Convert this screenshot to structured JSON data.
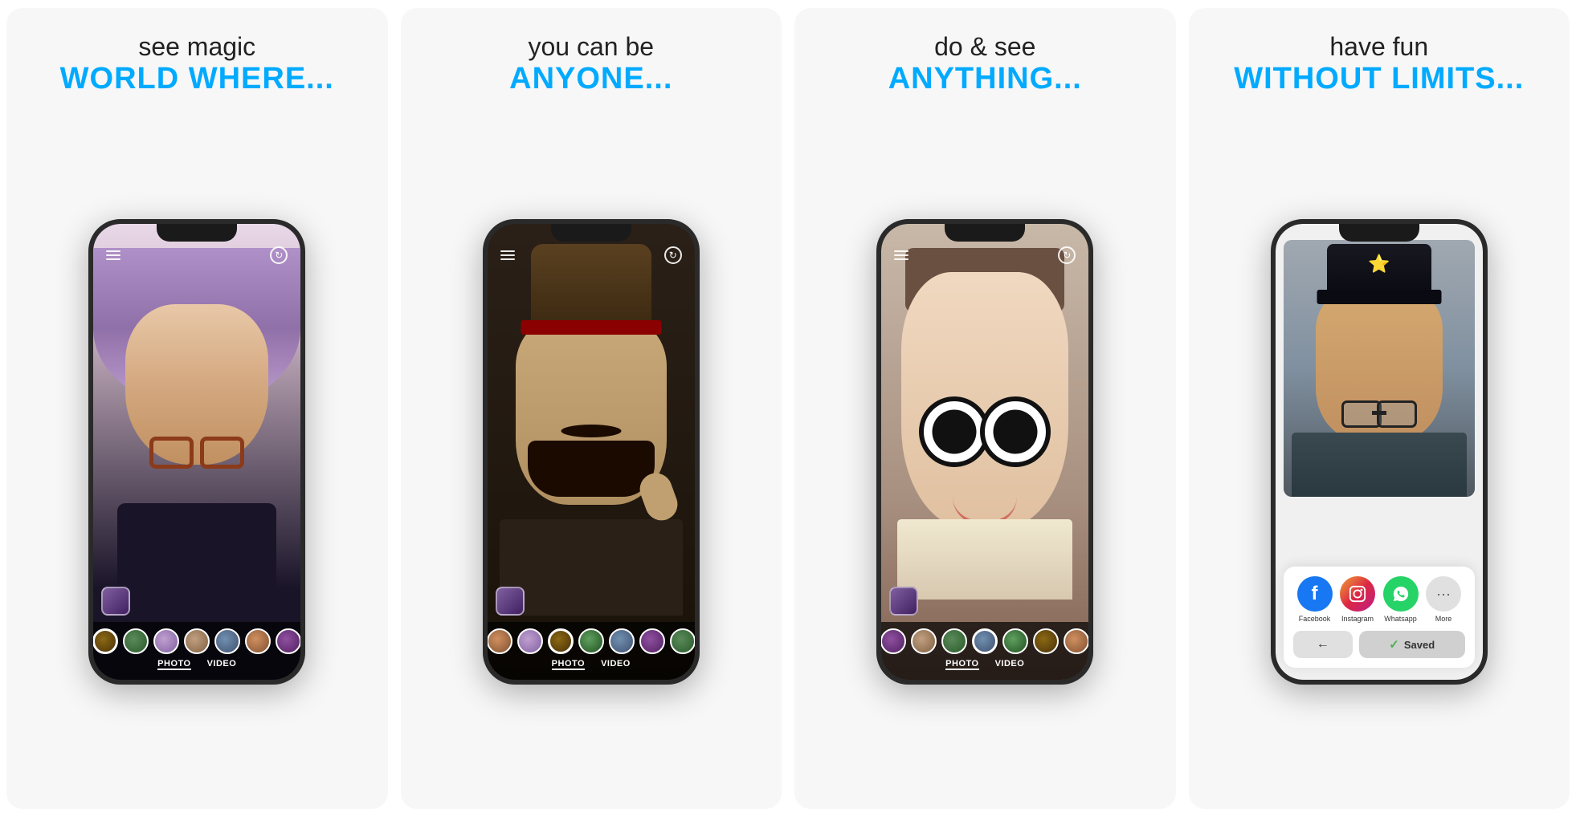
{
  "panels": [
    {
      "id": "panel1",
      "title_line1": "see magic",
      "title_line2": "WORLD WHERE...",
      "mode_photo": "PHOTO",
      "mode_video": "VIDEO"
    },
    {
      "id": "panel2",
      "title_line1": "you can be",
      "title_line2": "ANYONE...",
      "mode_photo": "PHOTO",
      "mode_video": "VIDEO"
    },
    {
      "id": "panel3",
      "title_line1": "do & see",
      "title_line2": "ANYTHING...",
      "mode_photo": "PHOTO",
      "mode_video": "VIDEO"
    },
    {
      "id": "panel4",
      "title_line1": "have fun",
      "title_line2": "WITHOUT LIMITS...",
      "share_apps": [
        {
          "name": "Facebook",
          "id": "facebook"
        },
        {
          "name": "Instagram",
          "id": "instagram"
        },
        {
          "name": "Whatsapp",
          "id": "whatsapp"
        },
        {
          "name": "More",
          "id": "more"
        }
      ],
      "back_arrow": "←",
      "saved_label": "✓ Saved"
    }
  ],
  "icons": {
    "hamburger": "☰",
    "camera_flip": "↻",
    "star": "⭐"
  }
}
